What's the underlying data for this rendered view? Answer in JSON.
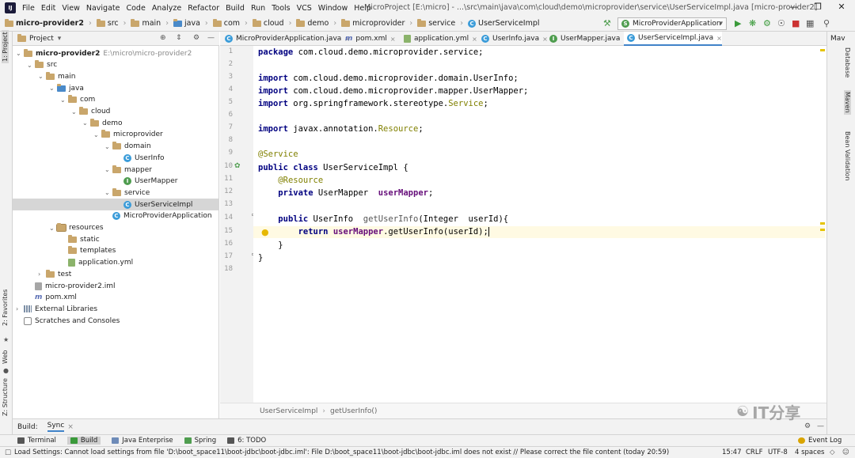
{
  "menu": [
    "File",
    "Edit",
    "View",
    "Navigate",
    "Code",
    "Analyze",
    "Refactor",
    "Build",
    "Run",
    "Tools",
    "VCS",
    "Window",
    "Help"
  ],
  "window_title": "MicroProject [E:\\micro] - ...\\src\\main\\java\\com\\cloud\\demo\\microprovider\\service\\UserServiceImpl.java [micro-provider2]",
  "breadcrumbs": [
    "micro-provider2",
    "src",
    "main",
    "java",
    "com",
    "cloud",
    "demo",
    "microprovider",
    "service",
    "UserServiceImpl"
  ],
  "run_config": "MicroProviderApplication",
  "project_panel": {
    "title": "Project",
    "tree": [
      {
        "label": "micro-provider2",
        "hint": "E:\\micro\\micro-provider2",
        "depth": 0,
        "icon": "module-folder-icon",
        "expanded": true
      },
      {
        "label": "src",
        "depth": 1,
        "icon": "folder-icon",
        "expanded": true
      },
      {
        "label": "main",
        "depth": 2,
        "icon": "folder-icon",
        "expanded": true
      },
      {
        "label": "java",
        "depth": 3,
        "icon": "source-folder-icon",
        "expanded": true
      },
      {
        "label": "com",
        "depth": 4,
        "icon": "package-icon",
        "expanded": true
      },
      {
        "label": "cloud",
        "depth": 5,
        "icon": "package-icon",
        "expanded": true
      },
      {
        "label": "demo",
        "depth": 6,
        "icon": "package-icon",
        "expanded": true
      },
      {
        "label": "microprovider",
        "depth": 7,
        "icon": "package-icon",
        "expanded": true
      },
      {
        "label": "domain",
        "depth": 8,
        "icon": "package-icon",
        "expanded": true
      },
      {
        "label": "UserInfo",
        "depth": 9,
        "icon": "class-icon"
      },
      {
        "label": "mapper",
        "depth": 8,
        "icon": "package-icon",
        "expanded": true
      },
      {
        "label": "UserMapper",
        "depth": 9,
        "icon": "interface-icon"
      },
      {
        "label": "service",
        "depth": 8,
        "icon": "package-icon",
        "expanded": true
      },
      {
        "label": "UserServiceImpl",
        "depth": 9,
        "icon": "class-icon",
        "selected": true
      },
      {
        "label": "MicroProviderApplication",
        "depth": 8,
        "icon": "spring-class-icon"
      },
      {
        "label": "resources",
        "depth": 3,
        "icon": "resources-folder-icon",
        "expanded": true
      },
      {
        "label": "static",
        "depth": 4,
        "icon": "folder-icon"
      },
      {
        "label": "templates",
        "depth": 4,
        "icon": "folder-icon"
      },
      {
        "label": "application.yml",
        "depth": 4,
        "icon": "yml-file-icon"
      },
      {
        "label": "test",
        "depth": 2,
        "icon": "folder-icon",
        "expanded": false
      },
      {
        "label": "micro-provider2.iml",
        "depth": 1,
        "icon": "iml-file-icon"
      },
      {
        "label": "pom.xml",
        "depth": 1,
        "icon": "maven-file-icon"
      },
      {
        "label": "External Libraries",
        "depth": 0,
        "icon": "libraries-icon",
        "expanded": false
      },
      {
        "label": "Scratches and Consoles",
        "depth": 0,
        "icon": "scratches-icon"
      }
    ]
  },
  "tabs": [
    {
      "label": "MicroProviderApplication.java",
      "icon": "class-icon",
      "active": false
    },
    {
      "label": "pom.xml",
      "icon": "maven-file-icon",
      "active": false
    },
    {
      "label": "application.yml",
      "icon": "yml-file-icon",
      "active": false
    },
    {
      "label": "UserInfo.java",
      "icon": "class-icon",
      "active": false
    },
    {
      "label": "UserMapper.java",
      "icon": "interface-icon",
      "active": false
    },
    {
      "label": "UserServiceImpl.java",
      "icon": "class-icon",
      "active": true
    }
  ],
  "editor": {
    "line_numbers": [
      "1",
      "2",
      "3",
      "4",
      "5",
      "6",
      "7",
      "8",
      "9",
      "10",
      "11",
      "12",
      "13",
      "14",
      "15",
      "16",
      "17",
      "18"
    ],
    "caret_line": 15
  },
  "editor_breadcrumb": [
    "UserServiceImpl",
    "getUserInfo()"
  ],
  "left_stripe": [
    "1: Project",
    "2: Favorites",
    "Web",
    "Z: Structure"
  ],
  "right_stripe": [
    "Database",
    "Maven",
    "Bean Validation"
  ],
  "right_stripe_top": "Mav",
  "build_bar": {
    "label": "Build:",
    "tab": "Sync"
  },
  "tool_windows": [
    {
      "label": "Terminal",
      "active": false
    },
    {
      "label": "Build",
      "active": true
    },
    {
      "label": "Java Enterprise",
      "active": false
    },
    {
      "label": "Spring",
      "active": false
    },
    {
      "label": "6: TODO",
      "active": false
    }
  ],
  "event_log": "Event Log",
  "status": {
    "message": "Load Settings: Cannot load settings from file 'D:\\boot_space11\\boot-jdbc\\boot-jdbc.iml': File D:\\boot_space11\\boot-jdbc\\boot-jdbc.iml does not exist // Please correct the file content (today 20:59)",
    "position": "15:47",
    "line_sep": "CRLF",
    "encoding": "UTF-8",
    "indent": "4 spaces"
  },
  "watermark": "IT分享",
  "colors": {
    "accent": "#4083c9",
    "keyword": "#000080",
    "annotation": "#808000",
    "field": "#660e7a",
    "caret_row": "#fffae3"
  }
}
